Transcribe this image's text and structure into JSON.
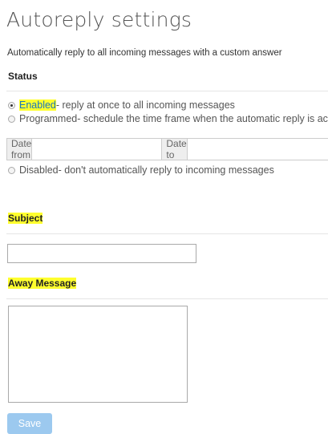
{
  "title": "Autoreply settings",
  "description": "Automatically reply to all incoming messages with a custom answer",
  "status": {
    "heading": "Status",
    "enabled": {
      "label": "Enabled",
      "text": " - reply at once to all incoming messages",
      "checked": true
    },
    "programmed": {
      "label": "Programmed",
      "text": " - schedule the time frame when the automatic reply is active",
      "checked": false
    },
    "date_from_label": "Date from",
    "date_to_label": "Date to",
    "disabled": {
      "label": "Disabled",
      "text": " - don't automatically reply to incoming messages",
      "checked": false
    }
  },
  "subject": {
    "heading": "Subject",
    "value": ""
  },
  "away_message": {
    "heading": "Away Message",
    "value": ""
  },
  "save_label": "Save",
  "colors": {
    "highlight": "#ffff2e",
    "save_button": "#9cc9ef",
    "enabled_label": "#1a75bb"
  }
}
